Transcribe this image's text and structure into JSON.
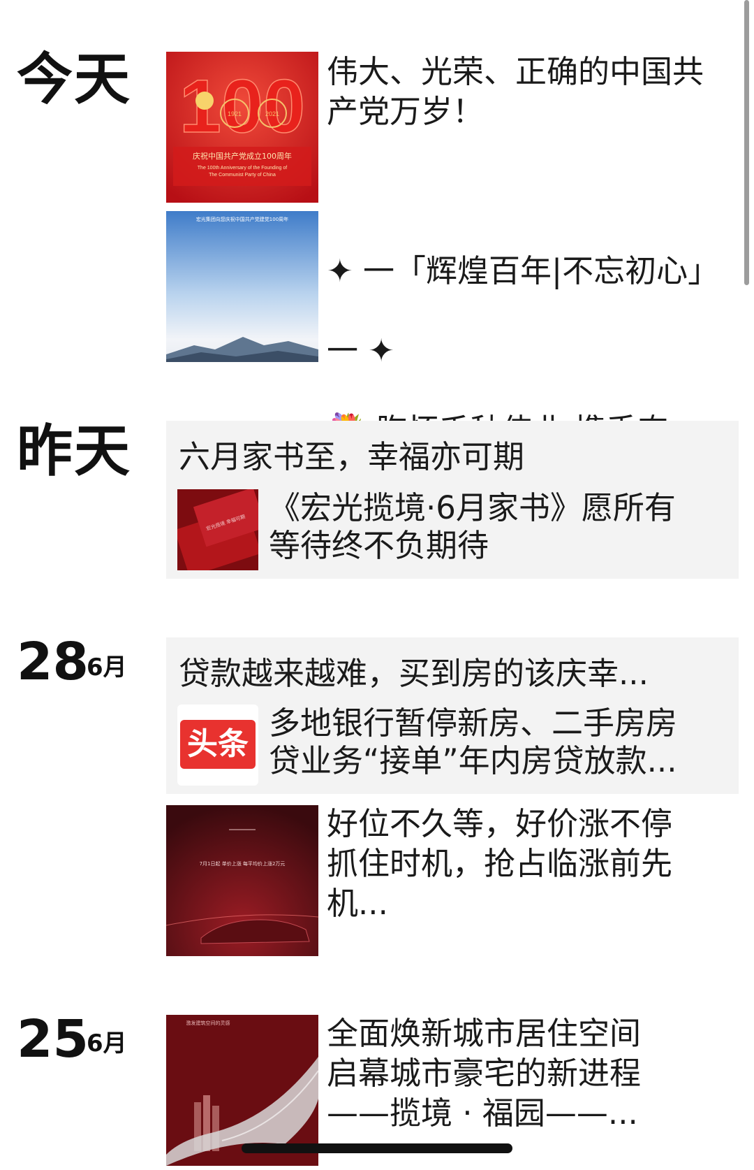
{
  "groups": {
    "today": {
      "date_label": "今天"
    },
    "yesterday": {
      "date_label": "昨天"
    },
    "jun28": {
      "day": "28",
      "month": "6月"
    },
    "jun25": {
      "day": "25",
      "month": "6月"
    }
  },
  "posts": {
    "party100": {
      "text": "伟大、光荣、正确的中国共\n产党万岁！",
      "image": {
        "big_number": "100",
        "year_left": "1921",
        "year_right": "2021",
        "caption_cn": "庆祝中国共产党成立100周年",
        "caption_en1": "The 100th Anniversary of the Founding of",
        "caption_en2": "The Communist Party of China"
      }
    },
    "huihuang": {
      "line1": "✦ 一「辉煌百年|不忘初心」",
      "line2": "一 ✦",
      "flower": "💐",
      "line3": " 胸怀千秋伟业  携手奋...",
      "image": {
        "caption": "宏光集团向您庆祝中国共产党建党100周年"
      }
    },
    "jiashu": {
      "share_title": "六月家书至，幸福亦可期",
      "share_desc": "《宏光揽境·6月家书》愿所有\n等待终不负期待",
      "image": {
        "card_text": "宏光揽境  幸福可期"
      }
    },
    "daikuan": {
      "share_title": "贷款越来越难，买到房的该庆幸...",
      "share_desc": "多地银行暂停新房、二手房房\n贷业务“接单”年内房贷放款...",
      "app_icon_text": "头条"
    },
    "haowei": {
      "text": "好位不久等，好价涨不停\n  抓住时机，抢占临涨前先\n机...",
      "image": {
        "small_text": "7月1日起 单价上涨 每平均价上涨2万元"
      }
    },
    "huanxin": {
      "text": "全面焕新城市居住空间\n     启幕城市豪宅的新进程\n         ——揽境 · 福园——...",
      "image": {
        "small_text": "激发建筑空间的灵感"
      }
    }
  },
  "colors": {
    "accent_red": "#c8161d",
    "card_bg": "#f3f3f3",
    "toutiao_red": "#e8322f"
  }
}
